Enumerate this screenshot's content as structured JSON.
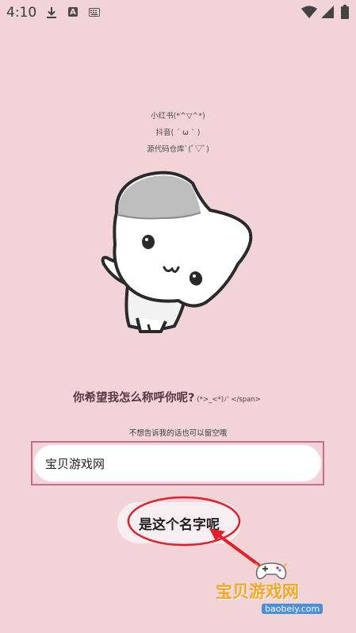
{
  "status_bar": {
    "time": "4:10",
    "a_badge": "A",
    "icons": [
      "download-icon",
      "a-badge-icon",
      "keyboard-icon",
      "wifi-icon",
      "signal-icon",
      "battery-icon"
    ]
  },
  "links": {
    "xiaohongshu": "小红书(*^▽^*)",
    "douyin": "抖音( ´ ω ` )",
    "source": "源代码仓库`(ﾟ▽ﾟ)"
  },
  "question": {
    "main": "你希望我怎么称呼你呢?",
    "emote": "(*>_<*)ﾉ' </span>"
  },
  "hint": "不想告诉我的话也可以留空哦",
  "name_input": {
    "value": "宝贝游戏网",
    "placeholder": ""
  },
  "confirm_button": {
    "label": "是这个名字呢"
  },
  "watermark": {
    "title": "宝贝游戏网",
    "url": "baobeiy.com"
  },
  "colors": {
    "background": "#f1d3d8",
    "input_frame": "#c47080",
    "annotation_red": "#e0202a",
    "watermark_orange": "#f5a623"
  }
}
